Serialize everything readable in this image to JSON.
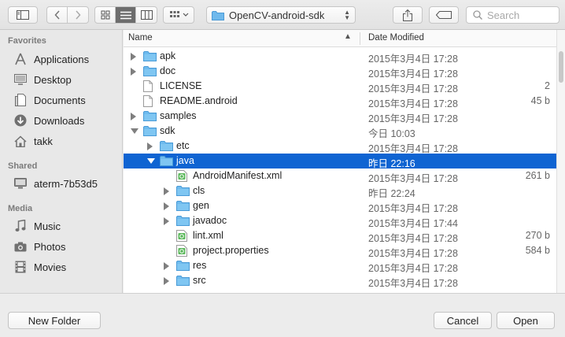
{
  "toolbar": {
    "path_label": "OpenCV-android-sdk",
    "search_placeholder": "Search"
  },
  "sidebar": {
    "sections": [
      {
        "title": "Favorites",
        "items": [
          {
            "label": "Applications",
            "icon": "applications-icon"
          },
          {
            "label": "Desktop",
            "icon": "desktop-icon"
          },
          {
            "label": "Documents",
            "icon": "documents-icon"
          },
          {
            "label": "Downloads",
            "icon": "downloads-icon"
          },
          {
            "label": "takk",
            "icon": "home-icon"
          }
        ]
      },
      {
        "title": "Shared",
        "items": [
          {
            "label": "aterm-7b53d5",
            "icon": "computer-icon"
          }
        ]
      },
      {
        "title": "Media",
        "items": [
          {
            "label": "Music",
            "icon": "music-icon"
          },
          {
            "label": "Photos",
            "icon": "camera-icon"
          },
          {
            "label": "Movies",
            "icon": "film-icon"
          }
        ]
      }
    ]
  },
  "columns": {
    "name": "Name",
    "date": "Date Modified"
  },
  "rows": [
    {
      "name": "apk",
      "date": "2015年3月4日 17:28",
      "size": "",
      "kind": "folder",
      "disclosure": "closed",
      "depth": 0
    },
    {
      "name": "doc",
      "date": "2015年3月4日 17:28",
      "size": "",
      "kind": "folder",
      "disclosure": "closed",
      "depth": 0
    },
    {
      "name": "LICENSE",
      "date": "2015年3月4日 17:28",
      "size": "2",
      "kind": "file",
      "disclosure": "none",
      "depth": 0
    },
    {
      "name": "README.android",
      "date": "2015年3月4日 17:28",
      "size": "45 b",
      "kind": "file",
      "disclosure": "none",
      "depth": 0
    },
    {
      "name": "samples",
      "date": "2015年3月4日 17:28",
      "size": "",
      "kind": "folder",
      "disclosure": "closed",
      "depth": 0
    },
    {
      "name": "sdk",
      "date": "今日 10:03",
      "size": "",
      "kind": "folder",
      "disclosure": "open",
      "depth": 0
    },
    {
      "name": "etc",
      "date": "2015年3月4日 17:28",
      "size": "",
      "kind": "folder",
      "disclosure": "closed",
      "depth": 1
    },
    {
      "name": "java",
      "date": "昨日 22:16",
      "size": "",
      "kind": "folder",
      "disclosure": "open",
      "depth": 1,
      "selected": true
    },
    {
      "name": "AndroidManifest.xml",
      "date": "2015年3月4日 17:28",
      "size": "261 b",
      "kind": "xml",
      "disclosure": "none",
      "depth": 2
    },
    {
      "name": "cls",
      "date": "昨日 22:24",
      "size": "",
      "kind": "folder",
      "disclosure": "closed",
      "depth": 2
    },
    {
      "name": "gen",
      "date": "2015年3月4日 17:28",
      "size": "",
      "kind": "folder",
      "disclosure": "closed",
      "depth": 2
    },
    {
      "name": "javadoc",
      "date": "2015年3月4日 17:44",
      "size": "",
      "kind": "folder",
      "disclosure": "closed",
      "depth": 2
    },
    {
      "name": "lint.xml",
      "date": "2015年3月4日 17:28",
      "size": "270 b",
      "kind": "xml",
      "disclosure": "none",
      "depth": 2
    },
    {
      "name": "project.properties",
      "date": "2015年3月4日 17:28",
      "size": "584 b",
      "kind": "xml",
      "disclosure": "none",
      "depth": 2
    },
    {
      "name": "res",
      "date": "2015年3月4日 17:28",
      "size": "",
      "kind": "folder",
      "disclosure": "closed",
      "depth": 2
    },
    {
      "name": "src",
      "date": "2015年3月4日 17:28",
      "size": "",
      "kind": "folder",
      "disclosure": "closed",
      "depth": 2
    }
  ],
  "buttons": {
    "new_folder": "New Folder",
    "cancel": "Cancel",
    "open": "Open"
  },
  "colors": {
    "selection": "#0f64d2",
    "folder": "#5fb3ea",
    "accent": "#0f64d2"
  }
}
